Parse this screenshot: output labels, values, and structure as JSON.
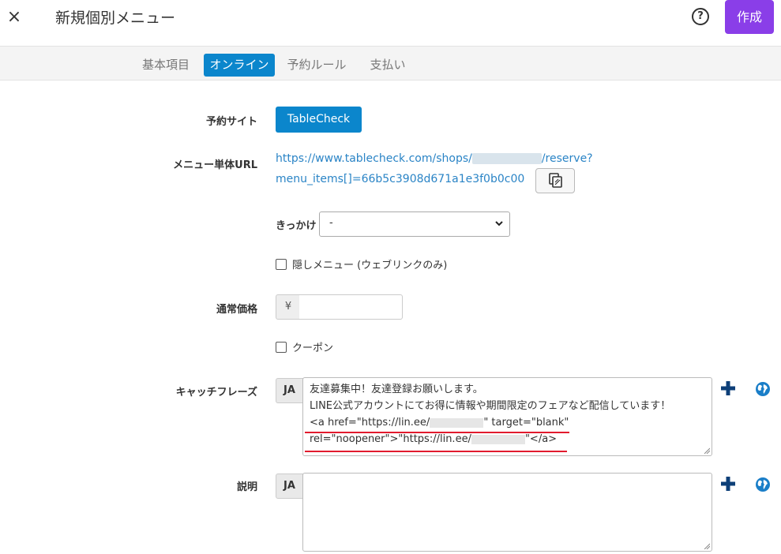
{
  "header": {
    "close_label": "×",
    "title": "新規個別メニュー",
    "help_label": "?",
    "create_label": "作成"
  },
  "tabs": [
    {
      "label": "基本項目",
      "active": false
    },
    {
      "label": "オンライン",
      "active": true
    },
    {
      "label": "予約ルール",
      "active": false
    },
    {
      "label": "支払い",
      "active": false
    }
  ],
  "form": {
    "reservation_site": {
      "label": "予約サイト",
      "value": "TableCheck"
    },
    "menu_url": {
      "label": "メニュー単体URL",
      "line1_prefix": "https://www.tablecheck.com/shops/",
      "line1_suffix": "/reserve?",
      "line2": "menu_items[]=66b5c3908d671a1e3f0b0c00"
    },
    "trigger": {
      "label": "きっかけ",
      "value": "-"
    },
    "hidden_menu": {
      "label": "隠しメニュー (ウェブリンクのみ)",
      "checked": false
    },
    "regular_price": {
      "label": "通常価格",
      "currency": "¥",
      "value": ""
    },
    "coupon": {
      "label": "クーポン",
      "checked": false
    },
    "catch_phrase": {
      "label": "キャッチフレーズ",
      "lang": "JA",
      "line1": "友達募集中！友達登録お願いします。",
      "line2": "LINE公式アカウントにてお得に情報や期間限定のフェアなど配信しています！",
      "line3_a": "<a href=\"https://lin.ee/",
      "line3_b": "\" target=\"blank\"",
      "line4_a": "rel=\"noopener\">\"https://lin.ee/",
      "line4_b": "\"</a>"
    },
    "description": {
      "label": "説明",
      "lang": "JA",
      "value": ""
    }
  },
  "colors": {
    "accent_blue": "#0b86cc",
    "create_purple": "#8a3ee8",
    "link_blue": "#2a84c6",
    "underline_red": "#e21b2e",
    "icon_navy": "#0d3f78"
  }
}
